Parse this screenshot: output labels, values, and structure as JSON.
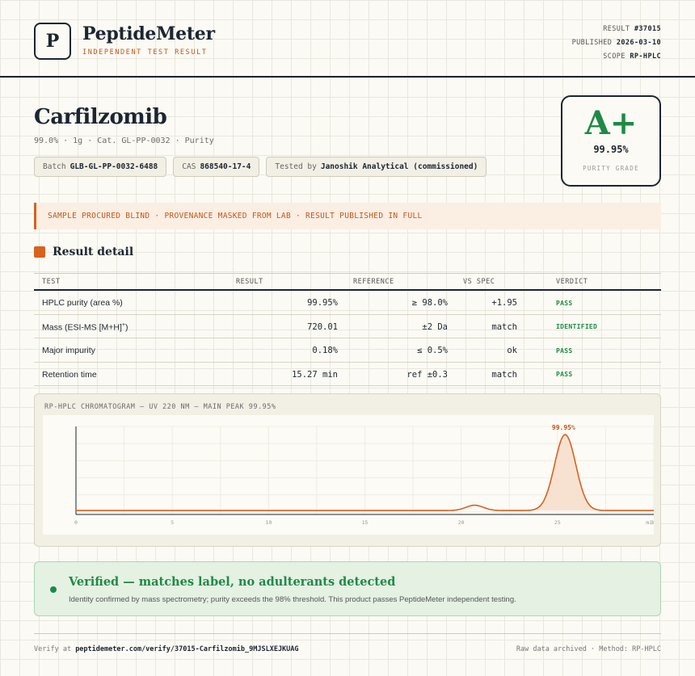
{
  "brand": {
    "logo_letter": "P",
    "name": "PeptideMeter",
    "tagline": "INDEPENDENT TEST RESULT"
  },
  "meta": {
    "result_label": "RESULT",
    "result_value": "#37015",
    "published_label": "PUBLISHED",
    "published_value": "2026-03-10",
    "scope_label": "SCOPE",
    "scope_value": "RP-HPLC"
  },
  "product": {
    "name": "Carfilzomib",
    "subtitle": "99.0% · 1g · Cat. GL-PP-0032 · Purity",
    "batch_label": "Batch",
    "batch_value": "GLB-GL-PP-0032-6488",
    "cas_label": "CAS",
    "cas_value": "868540-17-4",
    "tested_label": "Tested by",
    "tested_value": "Janoshik Analytical (commissioned)"
  },
  "grade": {
    "letter": "A+",
    "value": "99.95%",
    "label": "PURITY GRADE"
  },
  "notice": "SAMPLE PROCURED BLIND · PROVENANCE MASKED FROM LAB · RESULT PUBLISHED IN FULL",
  "section_title": "Result detail",
  "table": {
    "headers": {
      "test": "TEST",
      "result": "RESULT",
      "reference": "REFERENCE",
      "vs_spec": "VS SPEC",
      "verdict": "VERDICT"
    },
    "rows": [
      {
        "test": "HPLC purity (area %)",
        "result": "99.95%",
        "reference": "≥ 98.0%",
        "vs_spec": "+1.95",
        "verdict": "PASS"
      },
      {
        "test": "Mass (ESI-MS [M+H]",
        "test_sup": "+",
        "test_end": ")",
        "result": "720.01",
        "reference": "±2 Da",
        "vs_spec": "match",
        "verdict": "IDENTIFIED"
      },
      {
        "test": "Major impurity",
        "result": "0.18%",
        "reference": "≤ 0.5%",
        "vs_spec": "ok",
        "verdict": "PASS"
      },
      {
        "test": "Retention time",
        "result": "15.27 min",
        "reference": "ref ±0.3",
        "vs_spec": "match",
        "verdict": "PASS"
      }
    ]
  },
  "chromatogram": {
    "title": "RP-HPLC CHROMATOGRAM — UV 220 NM — MAIN PEAK 99.95%"
  },
  "chart_data": {
    "type": "line",
    "title": "RP-HPLC CHROMATOGRAM — UV 220 NM — MAIN PEAK 99.95%",
    "xlabel": "min",
    "ylabel": "",
    "xlim": [
      0,
      30
    ],
    "x_ticks": [
      0,
      5,
      10,
      15,
      20,
      25,
      30
    ],
    "peaks": [
      {
        "center": 20.7,
        "height": 0.07,
        "width": 0.45
      },
      {
        "center": 25.4,
        "height": 1.0,
        "width": 0.55
      }
    ],
    "baseline": 0.02,
    "main_peak_label": "99.95%",
    "line_color": "#d9621c",
    "fill_color": "#f7e2d2",
    "grid": true
  },
  "verified": {
    "title": "Verified — matches label, no adulterants detected",
    "text": "Identity confirmed by mass spectrometry; purity exceeds the 98% threshold. This product passes PeptideMeter independent testing."
  },
  "footer": {
    "verify_label": "Verify at",
    "verify_url": "peptidemeter.com/verify/37015-Carfilzomib_9MJSLXEJKUAG",
    "right": "Raw data archived · Method: RP-HPLC"
  },
  "colors": {
    "accent": "#d9621c",
    "pass": "#1e8a46",
    "ink": "#1c2530"
  }
}
